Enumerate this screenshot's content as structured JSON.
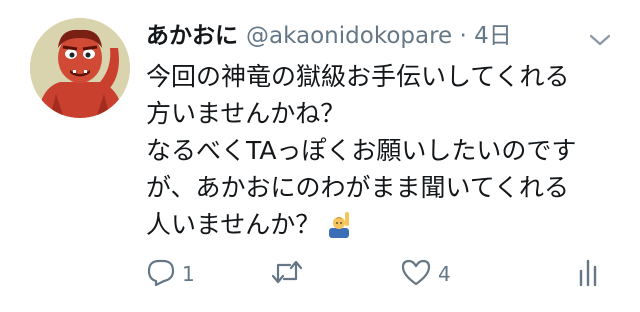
{
  "tweet": {
    "author_name": "あかおに",
    "author_handle": "@akaonidokopare",
    "separator": "·",
    "time": "4日",
    "text_lines": [
      "今回の神竜の獄級お手伝いしてくれる",
      "方いませんかね？",
      "なるべくTAっぽくお願いしたいのです",
      "が、あかおにのわがまま聞いてくれる",
      "人いませんか？"
    ],
    "emoji": "raising-hand-emoji"
  },
  "actions": {
    "reply_count": "1",
    "retweet_count": "",
    "like_count": "4"
  },
  "icons": {
    "reply": "reply-icon",
    "retweet": "retweet-icon",
    "like": "heart-icon",
    "share": "analytics-icon",
    "more": "chevron-down-icon"
  },
  "colors": {
    "text": "#14171a",
    "secondary": "#657786",
    "background": "#ffffff"
  }
}
